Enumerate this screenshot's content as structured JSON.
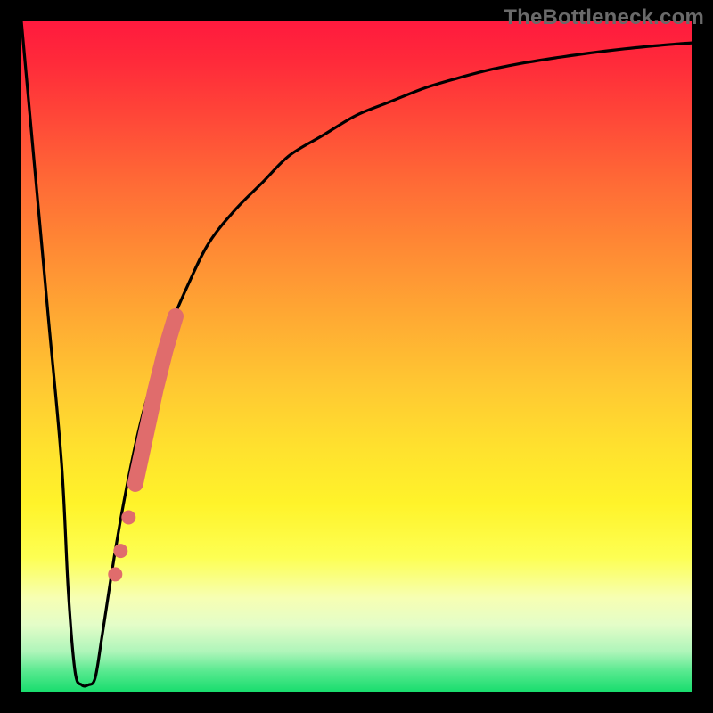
{
  "watermark": "TheBottleneck.com",
  "chart_data": {
    "type": "line",
    "title": "",
    "xlabel": "",
    "ylabel": "",
    "xlim": [
      0,
      100
    ],
    "ylim": [
      0,
      100
    ],
    "grid": false,
    "series": [
      {
        "name": "bottleneck-curve",
        "color": "#000000",
        "x": [
          0,
          2,
          4,
          6,
          7,
          8,
          9,
          10,
          11,
          12,
          14,
          16,
          18,
          20,
          22,
          25,
          28,
          32,
          36,
          40,
          45,
          50,
          55,
          60,
          65,
          70,
          75,
          80,
          85,
          90,
          95,
          100
        ],
        "y": [
          100,
          78,
          56,
          34,
          15,
          3,
          1,
          1,
          2,
          8,
          21,
          32,
          41,
          48,
          54,
          61,
          67,
          72,
          76,
          80,
          83,
          86,
          88,
          90,
          91.5,
          92.8,
          93.8,
          94.6,
          95.3,
          95.9,
          96.4,
          96.8
        ]
      }
    ],
    "markers": {
      "name": "highlight-segment",
      "color": "#e06c6c",
      "style": "thick-dotted",
      "points": [
        {
          "x": 14.0,
          "y": 17.5
        },
        {
          "x": 14.8,
          "y": 21.0
        },
        {
          "x": 16.0,
          "y": 26.0
        },
        {
          "x": 17.0,
          "y": 31.0
        },
        {
          "x": 18.5,
          "y": 38.0
        },
        {
          "x": 20.0,
          "y": 45.0
        },
        {
          "x": 21.5,
          "y": 51.0
        },
        {
          "x": 23.0,
          "y": 56.0
        }
      ]
    }
  }
}
